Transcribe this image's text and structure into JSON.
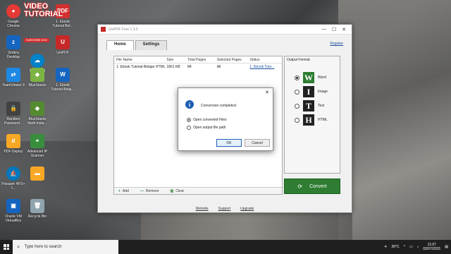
{
  "desktop": {
    "icons": [
      {
        "label": "Google Chrome",
        "color": "#e53935"
      },
      {
        "label": "Zimbra Desktop",
        "color": "#1565c0"
      },
      {
        "label": "TeamViewer 9",
        "color": "#1e88e5"
      },
      {
        "label": "Random Password...",
        "color": "#424242"
      },
      {
        "label": "PDF Deploy",
        "color": "#f9a825"
      },
      {
        "label": "Paragon HFS+ f...",
        "color": "#0277bd"
      },
      {
        "label": "Oracle VM VirtualBox",
        "color": "#1565c0"
      },
      {
        "label": "VirtualBox",
        "color": "#43a047"
      },
      {
        "label": "Nextcloud",
        "color": "#0082c9"
      },
      {
        "label": "BlueStacks",
        "color": "#7cb342"
      },
      {
        "label": "BlueStacks Multi-Insta...",
        "color": "#558b2f"
      },
      {
        "label": "Advanced IP Scanner",
        "color": "#388e3c"
      },
      {
        "label": "Recycle Bin",
        "color": "#90a4ae"
      },
      {
        "label": "1. Ebook Tutorial Bel...",
        "color": "#d32f2f"
      },
      {
        "label": "UniPDF",
        "color": "#c62828"
      },
      {
        "label": "1. Ebook Tutorial Belaj...",
        "color": "#1565c0"
      }
    ],
    "watermark": [
      "VIDEO",
      "TUTORIAL"
    ],
    "watermark_badge": "SUBSCRIBE NOW"
  },
  "window": {
    "title": "UniPDF Free 1.3.5",
    "min": "—",
    "max": "☐",
    "close": "✕",
    "tabs": [
      "Home",
      "Settings"
    ],
    "register": "Register",
    "table": {
      "headers": [
        "File Name",
        "Size",
        "Total Pages",
        "Selected Pages",
        "Status"
      ],
      "rows": [
        [
          "1. Ebook Tutorial Belajar HTML",
          "1861 KB",
          "84",
          "All",
          "1. Ebook Tuto..."
        ]
      ]
    },
    "footer": {
      "add": "Add",
      "remove": "Remove",
      "clear": "Clear"
    },
    "output_format": {
      "header": "Output Format:",
      "options": [
        {
          "glyph": "W",
          "label": "Word",
          "selected": true
        },
        {
          "glyph": "I",
          "label": "Image",
          "selected": false
        },
        {
          "glyph": "T",
          "label": "Text",
          "selected": false
        },
        {
          "glyph": "H",
          "label": "HTML",
          "selected": false
        }
      ]
    },
    "convert": "Convert",
    "bottom_links": [
      "Website",
      "Support",
      "Upgrade"
    ]
  },
  "dialog": {
    "message": "Conversion completed.",
    "options": [
      {
        "label": "Open converted Files",
        "selected": true
      },
      {
        "label": "Open output file path",
        "selected": false
      }
    ],
    "ok": "OK",
    "cancel": "Cancel"
  },
  "taskbar": {
    "search_placeholder": "Type here to search",
    "temp": "26°C",
    "time": "11:07",
    "date": "02/07/2021"
  }
}
